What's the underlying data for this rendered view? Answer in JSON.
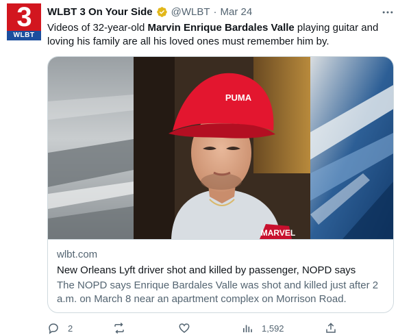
{
  "account": {
    "avatar_number": "3",
    "avatar_call_sign": "WLBT",
    "display_name": "WLBT 3 On Your Side",
    "handle": "@WLBT",
    "separator": "·",
    "date": "Mar 24",
    "verified_icon": "verified-badge-icon"
  },
  "tweet": {
    "text_before": "Videos of 32-year-old ",
    "text_bold": "Marvin Enrique Bardales Valle",
    "text_after": " playing guitar and loving his family are all his loved ones must remember him by."
  },
  "card": {
    "image_alt": "photo of a man in a red cap",
    "cap_logo_text": "PUMA",
    "shirt_logo_text": "MARVEL",
    "domain": "wlbt.com",
    "title": "New Orleans Lyft driver shot and killed by passenger, NOPD says",
    "description": "The NOPD says Enrique Bardales Valle was shot and killed just after 2 a.m. on March 8 near an apartment complex on Morrison Road."
  },
  "actions": {
    "reply_count": "2",
    "retweet_count": "",
    "like_count": "",
    "views_count": "1,592"
  },
  "colors": {
    "accent_red": "#d2161f",
    "accent_blue": "#1c4e9e",
    "verified_gold": "#e2b719",
    "muted_text": "#536471",
    "border": "#cfd9de"
  }
}
